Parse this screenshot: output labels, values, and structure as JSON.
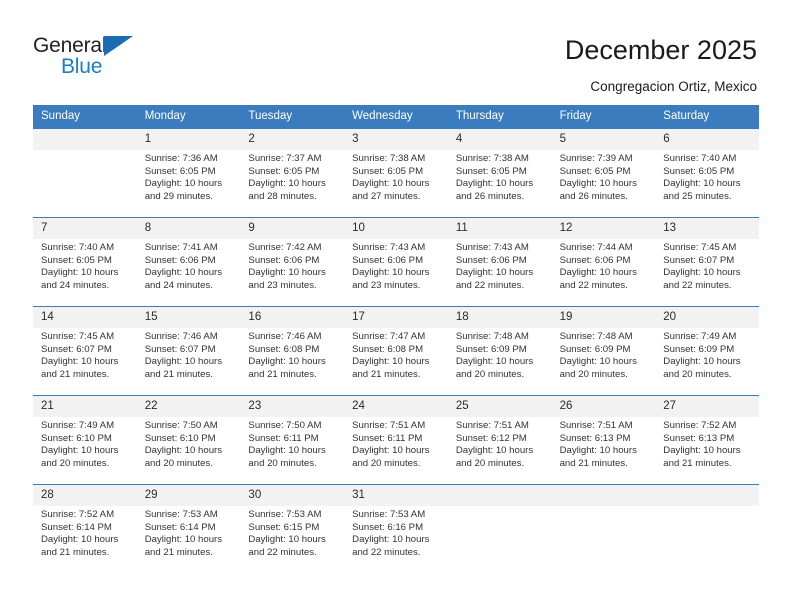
{
  "brand": {
    "name_top": "General",
    "name_bottom": "Blue",
    "triangle_color": "#1b6cb5",
    "blue_text_color": "#1b7ec9"
  },
  "header": {
    "title": "December 2025",
    "location": "Congregacion Ortiz, Mexico",
    "header_bg": "#3a7cbe",
    "header_text": "#ffffff",
    "daynum_bg": "#f2f2f2"
  },
  "weekdays": [
    "Sunday",
    "Monday",
    "Tuesday",
    "Wednesday",
    "Thursday",
    "Friday",
    "Saturday"
  ],
  "weeks": [
    [
      {
        "day": "",
        "lines": []
      },
      {
        "day": "1",
        "lines": [
          "Sunrise: 7:36 AM",
          "Sunset: 6:05 PM",
          "Daylight: 10 hours",
          "and 29 minutes."
        ]
      },
      {
        "day": "2",
        "lines": [
          "Sunrise: 7:37 AM",
          "Sunset: 6:05 PM",
          "Daylight: 10 hours",
          "and 28 minutes."
        ]
      },
      {
        "day": "3",
        "lines": [
          "Sunrise: 7:38 AM",
          "Sunset: 6:05 PM",
          "Daylight: 10 hours",
          "and 27 minutes."
        ]
      },
      {
        "day": "4",
        "lines": [
          "Sunrise: 7:38 AM",
          "Sunset: 6:05 PM",
          "Daylight: 10 hours",
          "and 26 minutes."
        ]
      },
      {
        "day": "5",
        "lines": [
          "Sunrise: 7:39 AM",
          "Sunset: 6:05 PM",
          "Daylight: 10 hours",
          "and 26 minutes."
        ]
      },
      {
        "day": "6",
        "lines": [
          "Sunrise: 7:40 AM",
          "Sunset: 6:05 PM",
          "Daylight: 10 hours",
          "and 25 minutes."
        ]
      }
    ],
    [
      {
        "day": "7",
        "lines": [
          "Sunrise: 7:40 AM",
          "Sunset: 6:05 PM",
          "Daylight: 10 hours",
          "and 24 minutes."
        ]
      },
      {
        "day": "8",
        "lines": [
          "Sunrise: 7:41 AM",
          "Sunset: 6:06 PM",
          "Daylight: 10 hours",
          "and 24 minutes."
        ]
      },
      {
        "day": "9",
        "lines": [
          "Sunrise: 7:42 AM",
          "Sunset: 6:06 PM",
          "Daylight: 10 hours",
          "and 23 minutes."
        ]
      },
      {
        "day": "10",
        "lines": [
          "Sunrise: 7:43 AM",
          "Sunset: 6:06 PM",
          "Daylight: 10 hours",
          "and 23 minutes."
        ]
      },
      {
        "day": "11",
        "lines": [
          "Sunrise: 7:43 AM",
          "Sunset: 6:06 PM",
          "Daylight: 10 hours",
          "and 22 minutes."
        ]
      },
      {
        "day": "12",
        "lines": [
          "Sunrise: 7:44 AM",
          "Sunset: 6:06 PM",
          "Daylight: 10 hours",
          "and 22 minutes."
        ]
      },
      {
        "day": "13",
        "lines": [
          "Sunrise: 7:45 AM",
          "Sunset: 6:07 PM",
          "Daylight: 10 hours",
          "and 22 minutes."
        ]
      }
    ],
    [
      {
        "day": "14",
        "lines": [
          "Sunrise: 7:45 AM",
          "Sunset: 6:07 PM",
          "Daylight: 10 hours",
          "and 21 minutes."
        ]
      },
      {
        "day": "15",
        "lines": [
          "Sunrise: 7:46 AM",
          "Sunset: 6:07 PM",
          "Daylight: 10 hours",
          "and 21 minutes."
        ]
      },
      {
        "day": "16",
        "lines": [
          "Sunrise: 7:46 AM",
          "Sunset: 6:08 PM",
          "Daylight: 10 hours",
          "and 21 minutes."
        ]
      },
      {
        "day": "17",
        "lines": [
          "Sunrise: 7:47 AM",
          "Sunset: 6:08 PM",
          "Daylight: 10 hours",
          "and 21 minutes."
        ]
      },
      {
        "day": "18",
        "lines": [
          "Sunrise: 7:48 AM",
          "Sunset: 6:09 PM",
          "Daylight: 10 hours",
          "and 20 minutes."
        ]
      },
      {
        "day": "19",
        "lines": [
          "Sunrise: 7:48 AM",
          "Sunset: 6:09 PM",
          "Daylight: 10 hours",
          "and 20 minutes."
        ]
      },
      {
        "day": "20",
        "lines": [
          "Sunrise: 7:49 AM",
          "Sunset: 6:09 PM",
          "Daylight: 10 hours",
          "and 20 minutes."
        ]
      }
    ],
    [
      {
        "day": "21",
        "lines": [
          "Sunrise: 7:49 AM",
          "Sunset: 6:10 PM",
          "Daylight: 10 hours",
          "and 20 minutes."
        ]
      },
      {
        "day": "22",
        "lines": [
          "Sunrise: 7:50 AM",
          "Sunset: 6:10 PM",
          "Daylight: 10 hours",
          "and 20 minutes."
        ]
      },
      {
        "day": "23",
        "lines": [
          "Sunrise: 7:50 AM",
          "Sunset: 6:11 PM",
          "Daylight: 10 hours",
          "and 20 minutes."
        ]
      },
      {
        "day": "24",
        "lines": [
          "Sunrise: 7:51 AM",
          "Sunset: 6:11 PM",
          "Daylight: 10 hours",
          "and 20 minutes."
        ]
      },
      {
        "day": "25",
        "lines": [
          "Sunrise: 7:51 AM",
          "Sunset: 6:12 PM",
          "Daylight: 10 hours",
          "and 20 minutes."
        ]
      },
      {
        "day": "26",
        "lines": [
          "Sunrise: 7:51 AM",
          "Sunset: 6:13 PM",
          "Daylight: 10 hours",
          "and 21 minutes."
        ]
      },
      {
        "day": "27",
        "lines": [
          "Sunrise: 7:52 AM",
          "Sunset: 6:13 PM",
          "Daylight: 10 hours",
          "and 21 minutes."
        ]
      }
    ],
    [
      {
        "day": "28",
        "lines": [
          "Sunrise: 7:52 AM",
          "Sunset: 6:14 PM",
          "Daylight: 10 hours",
          "and 21 minutes."
        ]
      },
      {
        "day": "29",
        "lines": [
          "Sunrise: 7:53 AM",
          "Sunset: 6:14 PM",
          "Daylight: 10 hours",
          "and 21 minutes."
        ]
      },
      {
        "day": "30",
        "lines": [
          "Sunrise: 7:53 AM",
          "Sunset: 6:15 PM",
          "Daylight: 10 hours",
          "and 22 minutes."
        ]
      },
      {
        "day": "31",
        "lines": [
          "Sunrise: 7:53 AM",
          "Sunset: 6:16 PM",
          "Daylight: 10 hours",
          "and 22 minutes."
        ]
      },
      {
        "day": "",
        "lines": []
      },
      {
        "day": "",
        "lines": []
      },
      {
        "day": "",
        "lines": []
      }
    ]
  ]
}
